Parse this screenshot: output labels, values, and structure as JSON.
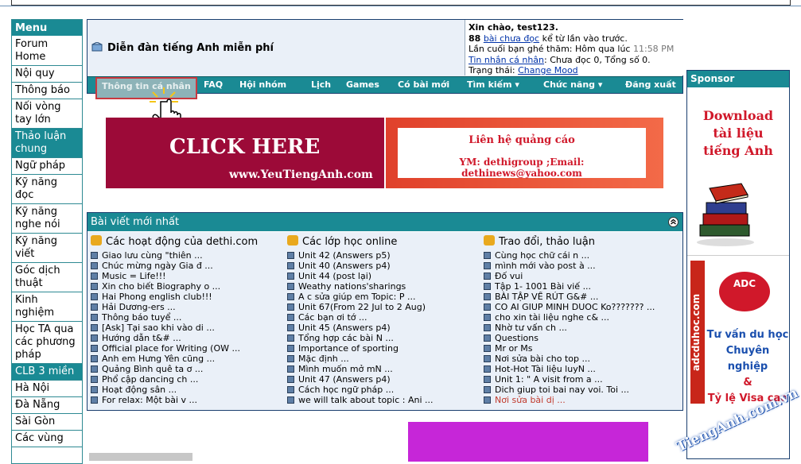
{
  "left_menu": {
    "header": "Menu",
    "items": [
      {
        "label": "Forum Home",
        "selected": false
      },
      {
        "label": "Nội quy",
        "selected": false
      },
      {
        "label": "Thông báo",
        "selected": false
      },
      {
        "label": "Nối vòng tay lớn",
        "selected": false
      },
      {
        "label": "Thảo luận chung",
        "selected": true
      },
      {
        "label": "Ngữ pháp",
        "selected": false
      },
      {
        "label": "Kỹ năng đọc",
        "selected": false
      },
      {
        "label": "Kỹ năng nghe nói",
        "selected": false
      },
      {
        "label": "Kỹ năng viết",
        "selected": false
      },
      {
        "label": "Góc dịch thuật",
        "selected": false
      },
      {
        "label": "Kinh nghiệm",
        "selected": false
      },
      {
        "label": "Học TA qua các phương pháp",
        "selected": false
      },
      {
        "label": "CLB 3 miền",
        "selected": true
      },
      {
        "label": "Hà Nội",
        "selected": false
      },
      {
        "label": "Đà Nẵng",
        "selected": false
      },
      {
        "label": "Sài Gòn",
        "selected": false
      },
      {
        "label": "Các vùng",
        "selected": false
      }
    ]
  },
  "forum": {
    "title": "Diễn đàn tiếng Anh miễn phí",
    "user": {
      "greeting": "Xin chào, test123.",
      "unread_count": "88",
      "unread_link": "bài chưa đọc",
      "unread_suffix": "kể từ lần vào trước.",
      "last_visit_label": "Lần cuối bạn ghé thăm: Hôm qua lúc",
      "last_visit_time": "11:58 PM",
      "pm_link": "Tin nhắn cá nhân",
      "pm_status": ": Chưa đọc 0, Tổng số 0.",
      "status_label": "Trạng thái:",
      "status_link": "Change Mood"
    }
  },
  "navbar": {
    "items": [
      "Thông tin cá nhân",
      "FAQ",
      "Hội nhóm",
      "Lịch",
      "Games",
      "Có bài mới",
      "Tìm kiếm ▾",
      "Chức năng ▾",
      "Đăng xuất"
    ]
  },
  "banner_left": {
    "headline": "CLICK HERE",
    "url": "www.YeuTiengAnh.com"
  },
  "banner_right": {
    "line1": "Liên hệ quảng cáo",
    "line2": "YM: dethigroup ;Email: dethinews@yahoo.com"
  },
  "latest": {
    "header": "Bài viết mới nhất",
    "columns": [
      {
        "title": "Các hoạt động của dethi.com",
        "posts": [
          "Giao lưu cùng \"thiên ...",
          "Chúc mừng ngày Gia đ ...",
          "Music = Life!!!",
          "Xin cho biết Biography o ...",
          "Hai Phong english club!!!",
          "Hải Dương-ers ...",
          "Thông báo tuyể ...",
          "[Ask] Tại sao khi vào di ...",
          "Hướng dẫn t&# ...",
          "Official place for Writing (OW ...",
          "Anh em Hưng Yên cũng ...",
          "Quảng Bình quê ta ơ ...",
          "Phổ cập dancing ch ...",
          "Hoạt động sân ...",
          "For relax: Một bài v ..."
        ]
      },
      {
        "title": "Các lớp học online",
        "posts": [
          "Unit 42 (Answers p5)",
          "Unit 40 (Answers p4)",
          "Unit 44 (post lại)",
          "Weathy nations'sharings",
          "A c sửa giúp em Topic: P ...",
          "Unit 67(From 22 Jul to 2 Aug)",
          "Các bạn ơi tớ ...",
          "Unit 45 (Answers p4)",
          "Tổng hợp các bài N ...",
          "Importance of sporting",
          "Mặc định ...",
          "Mình muốn mở mN ...",
          "Unit 47 (Answers p4)",
          "Cách học ngữ pháp ...",
          "we will talk about topic : Ani ..."
        ]
      },
      {
        "title": "Trao đổi, thảo luận",
        "posts": [
          "Cùng học chữ cái n ...",
          "mình mới vào post à ...",
          "Đố vui",
          "Tập 1- 1001 Bài viế ...",
          "BÀI TẬP VỀ RÚT G&# ...",
          "CO AI GIUP MINH DUOC Ko??????? ...",
          "cho xin tài liệu nghe c& ...",
          "Nhờ tư vấn ch ...",
          "Questions",
          "Mr or Ms",
          "Nơi sửa bài cho top ...",
          "Hot-Hot Tài liệu luyN ...",
          "Unit 1: \" A visit from a ...",
          "Dich giup toi bai nay voi. Toi ...",
          "Nơi sửa bài dị ..."
        ]
      }
    ]
  },
  "sponsor": {
    "header": "Sponsor",
    "download": "Download tài liệu tiếng Anh",
    "adc_logo": "ADC",
    "adc_side": "adcduhoc.com",
    "adc_text1": "Tư vấn du học",
    "adc_text2": "Chuyên nghiệp",
    "adc_text3": "&",
    "adc_text4": "Tỷ lệ Visa cao",
    "watermark": "TiengAnh.com.vn"
  },
  "colors": {
    "teal": "#1a8a94",
    "navy": "#1a3f6f",
    "banner_red": "#9c0a38",
    "link_blue": "#0033aa"
  }
}
